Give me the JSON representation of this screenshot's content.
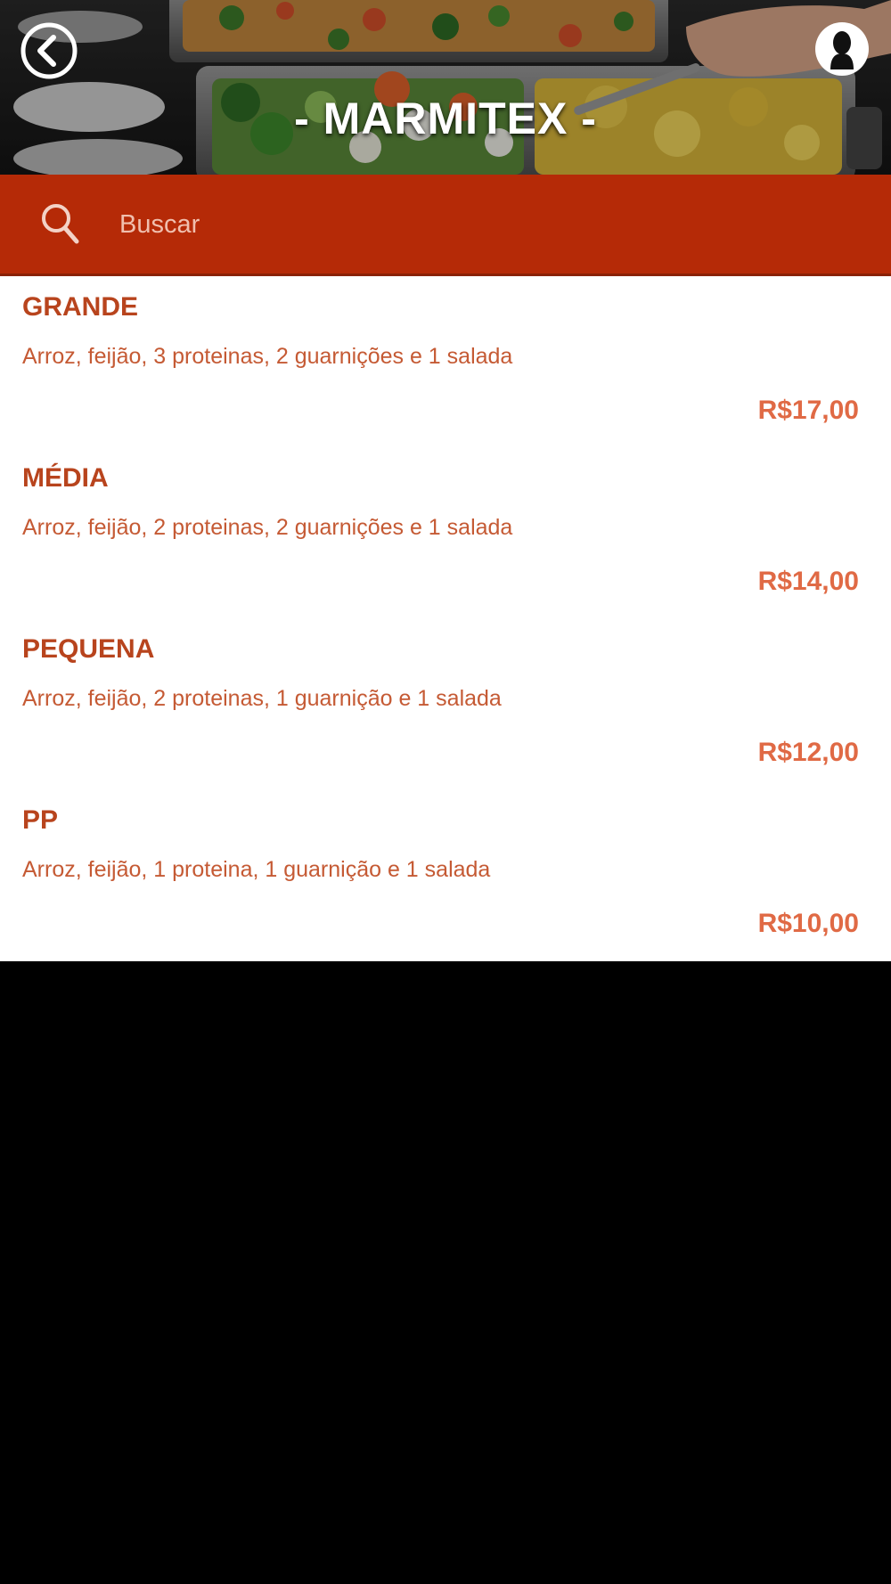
{
  "header": {
    "title": "- MARMITEX -",
    "back_icon": "chevron-left-circle-icon",
    "profile_icon": "user-silhouette-icon"
  },
  "search": {
    "placeholder": "Buscar",
    "value": "",
    "icon": "search-icon"
  },
  "colors": {
    "accent": "#b52a07",
    "item_name": "#b8441d",
    "item_desc": "#c55a34",
    "item_price": "#e06a45",
    "list_background": "#ffffff",
    "page_background": "#000000"
  },
  "menu": {
    "items": [
      {
        "name": "GRANDE",
        "description": "Arroz, feijão, 3 proteinas, 2 guarnições e 1 salada",
        "price": "R$17,00"
      },
      {
        "name": "MÉDIA",
        "description": "Arroz, feijão, 2 proteinas, 2 guarnições e 1 salada",
        "price": "R$14,00"
      },
      {
        "name": "PEQUENA",
        "description": "Arroz, feijão, 2 proteinas, 1 guarnição e 1 salada",
        "price": "R$12,00"
      },
      {
        "name": "PP",
        "description": "Arroz, feijão, 1 proteina, 1 guarnição e 1 salada",
        "price": "R$10,00"
      }
    ]
  }
}
